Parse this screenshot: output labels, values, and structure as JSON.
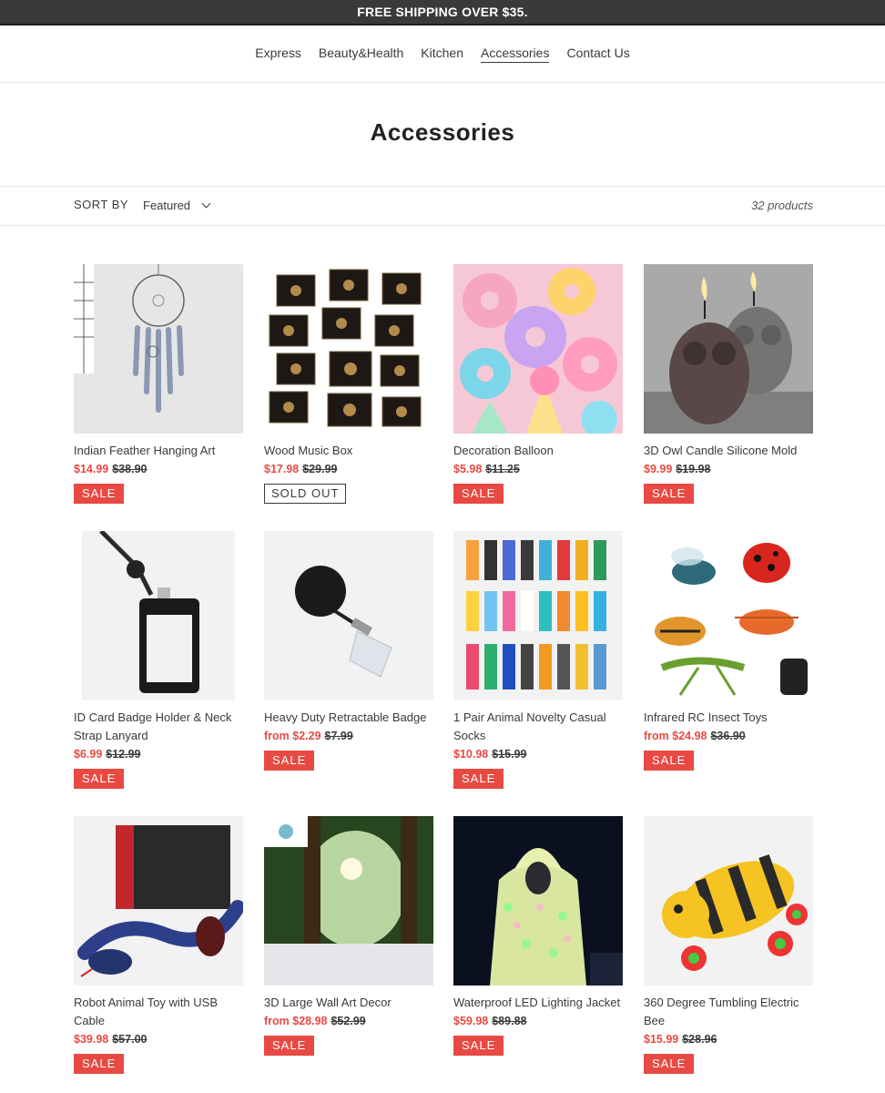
{
  "announcement": "FREE SHIPPING OVER $35.",
  "nav": [
    "Express",
    "Beauty&Health",
    "Kitchen",
    "Accessories",
    "Contact Us"
  ],
  "nav_active": "Accessories",
  "collection": {
    "title": "Accessories",
    "sort_label": "SORT BY",
    "sort_value": "Featured",
    "product_count": "32 products"
  },
  "colors": {
    "sale": "#e84a43",
    "text": "#3a3a3a",
    "announcement_bg": "#3a3a3a"
  },
  "products": [
    {
      "title": "Indian Feather Hanging Art",
      "price": "$14.99",
      "compare": "$38.90",
      "badge": "SALE"
    },
    {
      "title": "Wood Music Box",
      "price": "$17.98",
      "compare": "$29.99",
      "badge": "SOLD OUT"
    },
    {
      "title": "Decoration Balloon",
      "price": "$5.98",
      "compare": "$11.25",
      "badge": "SALE"
    },
    {
      "title": "3D Owl Candle Silicone Mold",
      "price": "$9.99",
      "compare": "$19.98",
      "badge": "SALE"
    },
    {
      "title": "ID Card Badge Holder & Neck Strap Lanyard",
      "price": "$6.99",
      "compare": "$12.99",
      "badge": "SALE"
    },
    {
      "title": "Heavy Duty Retractable Badge",
      "price": "from $2.29",
      "compare": "$7.99",
      "badge": "SALE"
    },
    {
      "title": "1 Pair Animal Novelty Casual Socks",
      "price": "$10.98",
      "compare": "$15.99",
      "badge": "SALE"
    },
    {
      "title": "Infrared RC Insect Toys",
      "price": "from $24.98",
      "compare": "$36.90",
      "badge": "SALE"
    },
    {
      "title": "Robot Animal Toy with USB Cable",
      "price": "$39.98",
      "compare": "$57.00",
      "badge": "SALE"
    },
    {
      "title": "3D Large Wall Art Decor",
      "price": "from $28.98",
      "compare": "$52.99",
      "badge": "SALE"
    },
    {
      "title": "Waterproof LED Lighting Jacket",
      "price": "$59.98",
      "compare": "$89.88",
      "badge": "SALE"
    },
    {
      "title": "360 Degree Tumbling Electric Bee",
      "price": "$15.99",
      "compare": "$28.96",
      "badge": "SALE"
    }
  ]
}
